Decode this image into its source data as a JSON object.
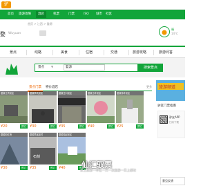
{
  "site": {
    "logo_text": "驴"
  },
  "nav": {
    "items": [
      {
        "label": "首页",
        "active": false
      },
      {
        "label": "旅游攻略",
        "active": false
      },
      {
        "label": "酒店",
        "active": true
      },
      {
        "label": "机票",
        "active": false
      },
      {
        "label": "门票",
        "active": false
      },
      {
        "label": "ISO",
        "active": false
      },
      {
        "label": "城市",
        "active": false
      },
      {
        "label": "社区",
        "active": false
      }
    ]
  },
  "breadcrumb": "首页 > 江西 > 婺源",
  "title": "婺",
  "subtitle": "Wuyuan",
  "weather": {
    "label": "晴",
    "temp": "14℃"
  },
  "tabs": [
    {
      "label": "景点"
    },
    {
      "label": "线路"
    },
    {
      "label": "美食"
    },
    {
      "label": "住宿"
    },
    {
      "label": "交通"
    },
    {
      "label": "旅游攻略"
    },
    {
      "label": "旅游问答"
    }
  ],
  "search": {
    "scope": "景点",
    "query": "婺源",
    "button": "搜索景点"
  },
  "section": {
    "tab_on": "景点门票",
    "tab_off": "特价酒店",
    "more": "更多"
  },
  "cards": [
    {
      "caption": "婺源江湾景区",
      "price": "¥20",
      "btn": "预订"
    },
    {
      "caption": "婺源李坑景区",
      "price": "¥30",
      "btn": "预订"
    },
    {
      "caption": "婺源汪口景区",
      "price": "¥35",
      "btn": "预订"
    },
    {
      "caption": "婺源江岭景区",
      "price": "¥40",
      "btn": "预订"
    },
    {
      "caption": "婺源篁岭景区",
      "price": "¥25",
      "btn": "预订"
    },
    {
      "caption": "婺源彩虹桥",
      "price": "¥30",
      "btn": "预订"
    },
    {
      "caption": "婺源思溪延村",
      "price": "¥35",
      "btn": "预订"
    },
    {
      "caption": "婺源晓起景区",
      "price": "¥40",
      "btn": "预订"
    }
  ],
  "ad": {
    "text": "旅游频道"
  },
  "side": {
    "label": "驴友门票指南",
    "app_title": "驴友APP",
    "app_sub": "扫码下载"
  },
  "watermark": {
    "main": "仙汇驭票",
    "sub": "景上旅游一单位一天一次旅游一日上都坊"
  },
  "fab": "意见反馈",
  "colors": {
    "brand": "#12a53a",
    "accent": "#e66000"
  }
}
